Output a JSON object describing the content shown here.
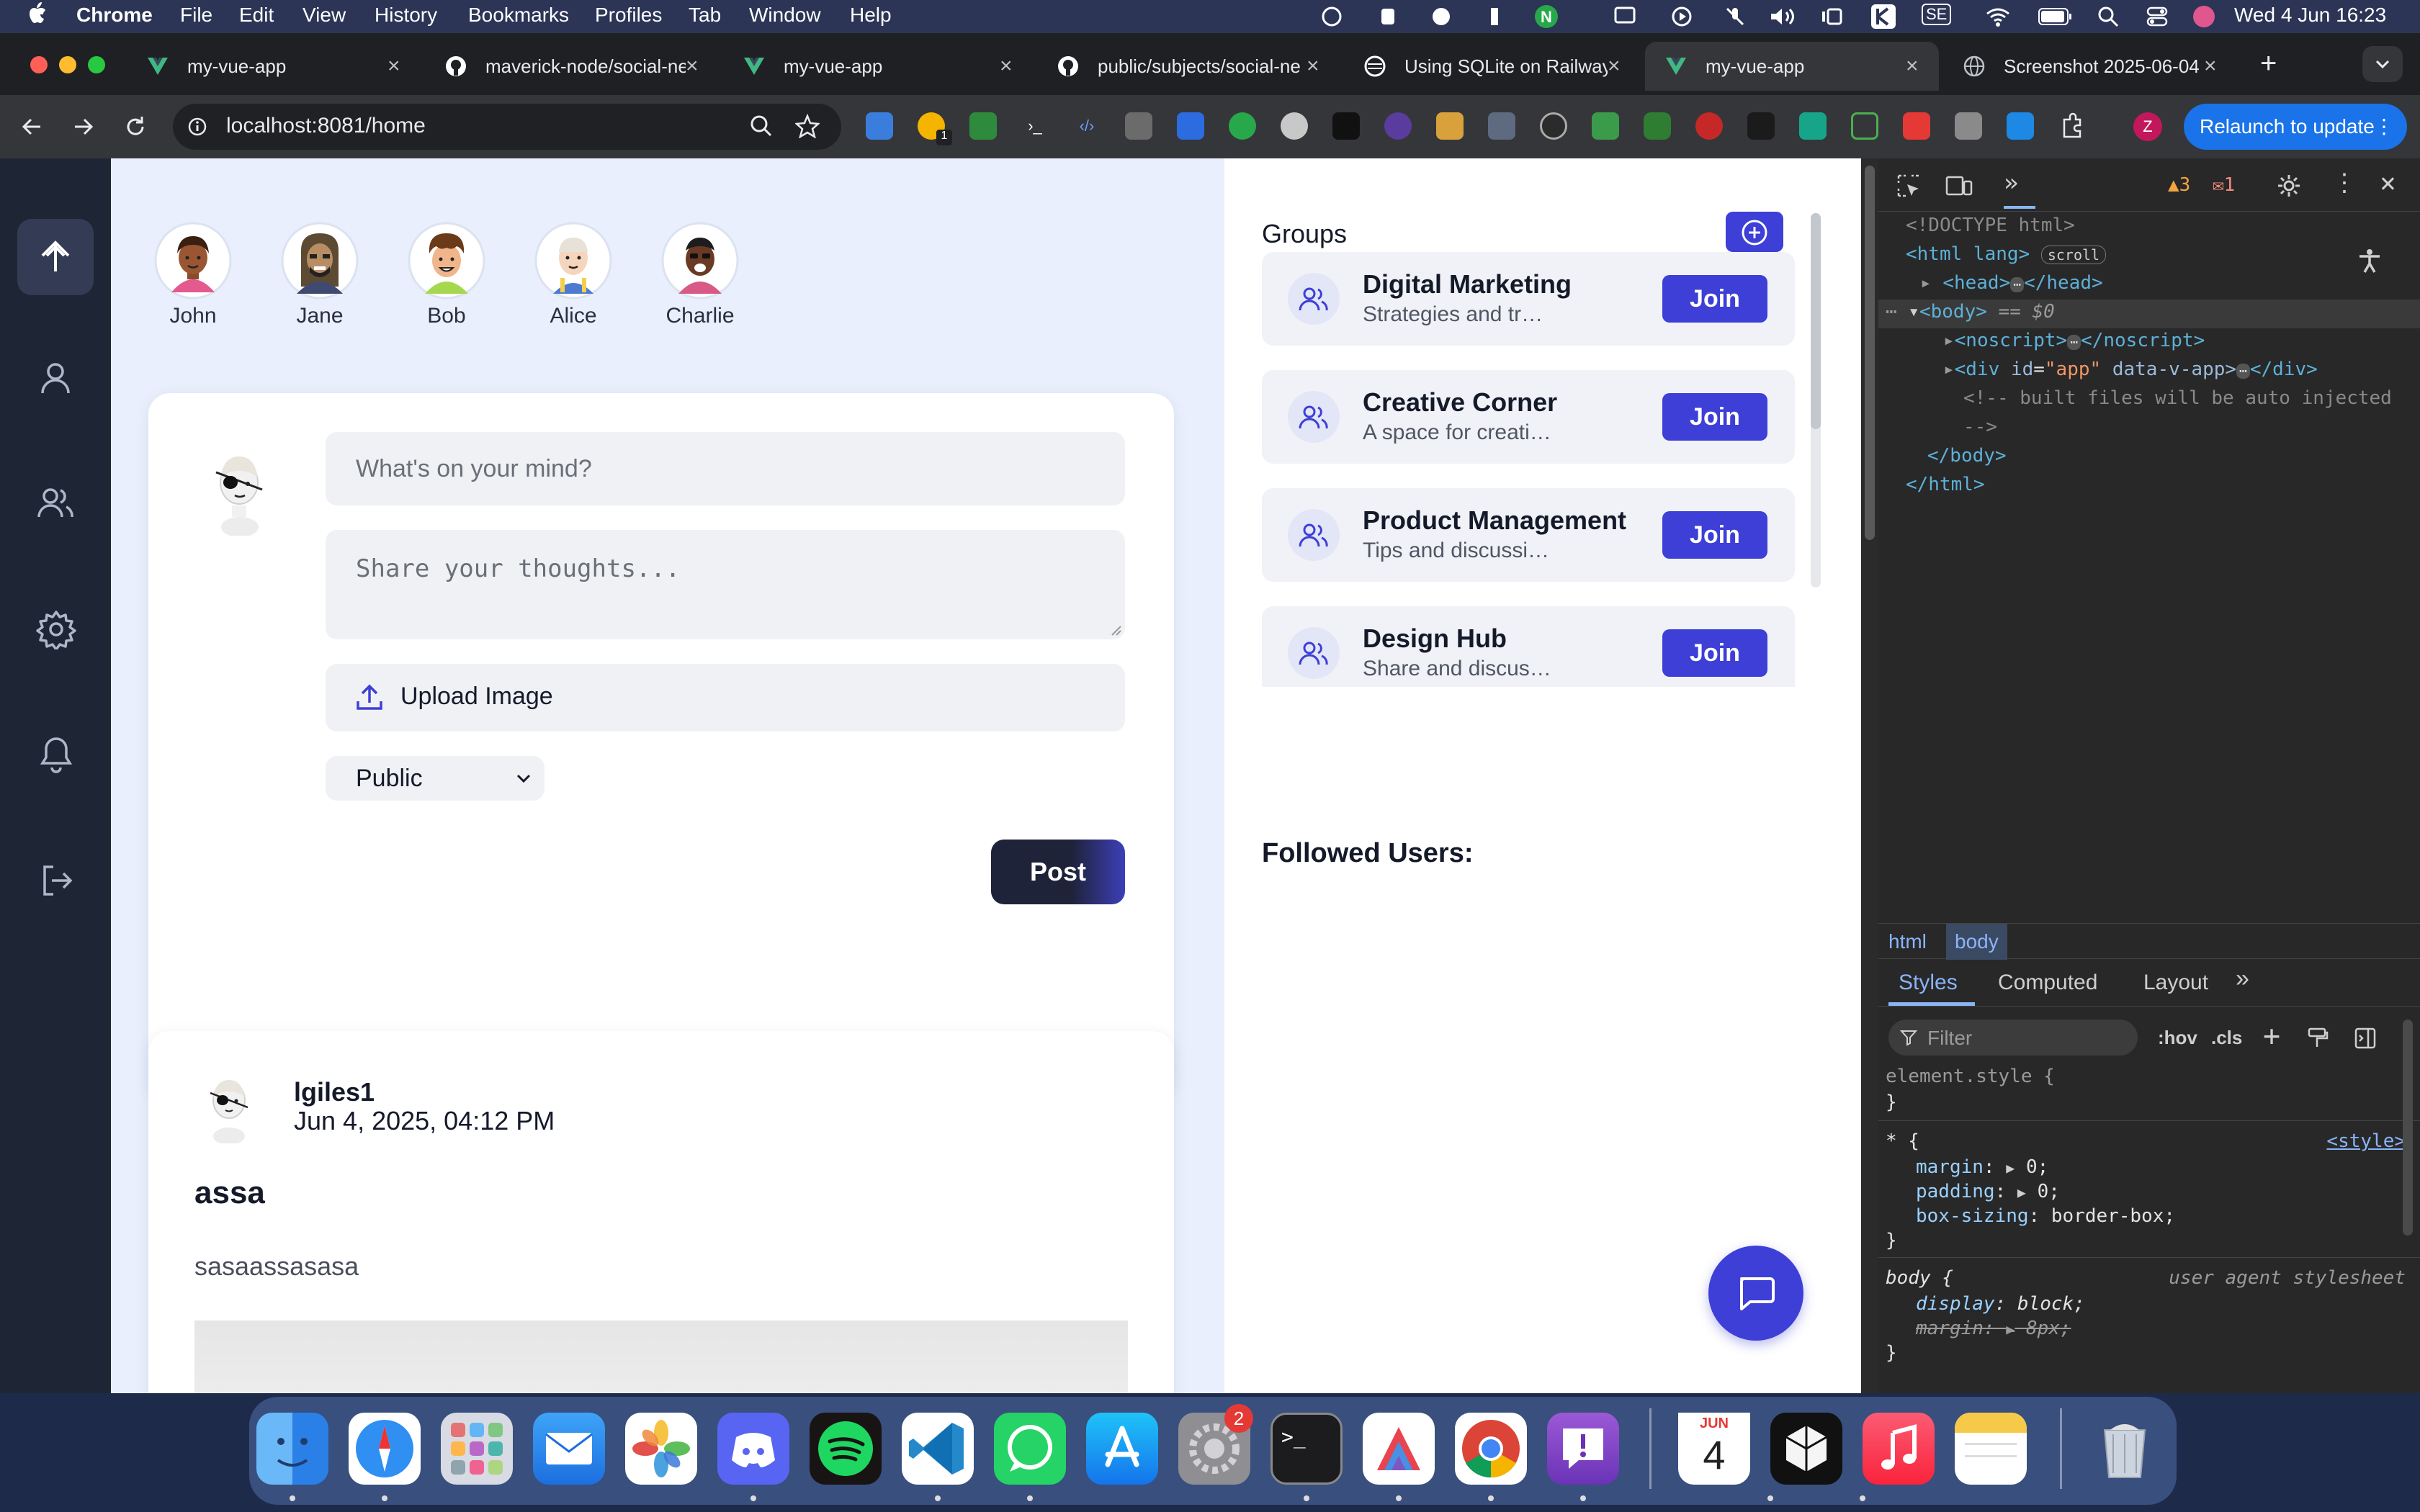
{
  "menubar": {
    "apple_icon": "apple-logo",
    "items": [
      "Chrome",
      "File",
      "Edit",
      "View",
      "History",
      "Bookmarks",
      "Profiles",
      "Tab",
      "Window",
      "Help"
    ],
    "clock": "Wed 4 Jun  16:23",
    "input_source": "SE"
  },
  "tabs": [
    {
      "title": "my-vue-app",
      "icon": "vue-icon"
    },
    {
      "title": "maverick-node/social-ne",
      "icon": "github-icon"
    },
    {
      "title": "my-vue-app",
      "icon": "vue-icon"
    },
    {
      "title": "public/subjects/social-ne",
      "icon": "github-icon"
    },
    {
      "title": "Using SQLite on Railway",
      "icon": "railway-icon"
    },
    {
      "title": "my-vue-app",
      "icon": "vue-icon",
      "active": true
    },
    {
      "title": "Screenshot 2025-06-04",
      "icon": "globe-icon"
    }
  ],
  "toolbar": {
    "url": "localhost:8081/home",
    "relaunch_label": "Relaunch to update",
    "profile_initial": "Z",
    "extension_badge": "1"
  },
  "sidebar": {
    "items": [
      {
        "name": "home",
        "icon": "arrow-up-icon",
        "active": true
      },
      {
        "name": "profile",
        "icon": "user-icon"
      },
      {
        "name": "friends",
        "icon": "users-icon"
      },
      {
        "name": "settings",
        "icon": "gear-icon"
      },
      {
        "name": "notifications",
        "icon": "bell-icon"
      },
      {
        "name": "logout",
        "icon": "logout-icon"
      }
    ]
  },
  "stories": [
    {
      "name": "John"
    },
    {
      "name": "Jane"
    },
    {
      "name": "Bob"
    },
    {
      "name": "Alice"
    },
    {
      "name": "Charlie"
    }
  ],
  "composer": {
    "title_placeholder": "What's on your mind?",
    "body_placeholder": "Share your thoughts...",
    "upload_label": "Upload Image",
    "privacy_selected": "Public",
    "post_label": "Post"
  },
  "post": {
    "author": "lgiles1",
    "timestamp": "Jun 4, 2025, 04:12 PM",
    "title": "assa",
    "body": "sasaassasasa"
  },
  "groups": {
    "heading": "Groups",
    "join_label": "Join",
    "items": [
      {
        "name": "Digital Marketing",
        "desc": "Strategies and tr…"
      },
      {
        "name": "Creative Corner",
        "desc": "A space for creati…"
      },
      {
        "name": "Product Management",
        "desc": "Tips and discussi…"
      },
      {
        "name": "Design Hub",
        "desc": "Share and discus…"
      }
    ]
  },
  "followed": {
    "heading": "Followed Users:"
  },
  "devtools": {
    "warnings": "3",
    "errors": "1",
    "dom": {
      "doctype": "<!DOCTYPE html>",
      "html_open": "<html lang>",
      "scroll_badge": "scroll",
      "head": "<head>",
      "head_close": "</head>",
      "body_open": "<body>",
      "body_marker": "== $0",
      "noscript": "<noscript>",
      "noscript_close": "</noscript>",
      "div_open": "<div",
      "div_id_attr": "id",
      "div_id_val": "\"app\"",
      "div_attr2": "data-v-app>",
      "div_close": "</div>",
      "comment_1": "<!-- built files will be auto injected",
      "comment_2": "-->",
      "body_close": "</body>",
      "html_close": "</html>"
    },
    "breadcrumbs": [
      "html",
      "body"
    ],
    "tabs": [
      "Styles",
      "Computed",
      "Layout"
    ],
    "filter_placeholder": "Filter",
    "hov": ":hov",
    "cls": ".cls",
    "styles": {
      "element_style": "element.style {",
      "close_brace": "}",
      "rule1_selector": "* {",
      "rule1_source": "<style>",
      "rule1_props": [
        {
          "prop": "margin",
          "value": "0;"
        },
        {
          "prop": "padding",
          "value": "0;"
        },
        {
          "prop": "box-sizing",
          "value": "border-box;"
        }
      ],
      "rule2_selector": "body {",
      "rule2_source": "user agent stylesheet",
      "rule2_props": [
        {
          "prop": "display",
          "value": "block;"
        },
        {
          "prop": "margin",
          "value": "8px;"
        }
      ]
    }
  },
  "dock": {
    "apps": [
      "Finder",
      "Safari",
      "Launchpad",
      "Mail",
      "Photos",
      "Discord",
      "Spotify",
      "VS Code",
      "WhatsApp",
      "App Store",
      "System Settings",
      "Terminal",
      "Affinity",
      "Chrome",
      "Feedback Assistant",
      "Calendar",
      "Blender",
      "Music",
      "Notes",
      "Trash"
    ],
    "settings_badge": "2",
    "calendar_month": "JUN",
    "calendar_day": "4"
  },
  "colors": {
    "accent": "#3d3fd6",
    "sidebar_bg": "#1e2535",
    "feed_bg": "#e9effc",
    "post_button": "#1e2339",
    "chrome_dark": "#35363a",
    "relaunch": "#1a73e8"
  }
}
